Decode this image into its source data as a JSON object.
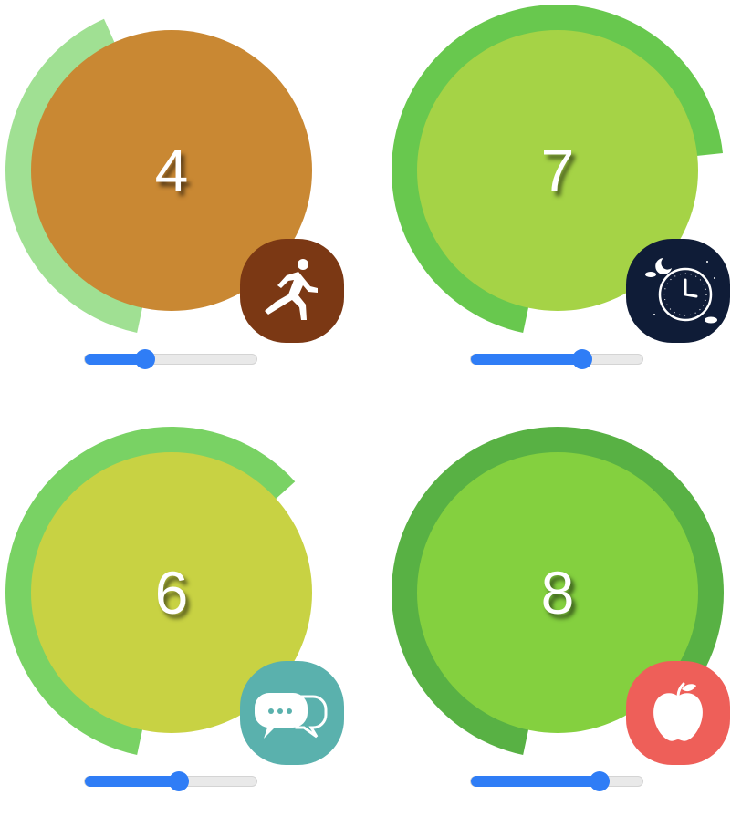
{
  "gauges": [
    {
      "name": "activity",
      "value": "4",
      "level": 0.4,
      "ring_color": "#a0e093",
      "inner_color": "#c98833",
      "badge_color": "#7b3814",
      "icon": "runner-icon",
      "slider_fraction": 0.35
    },
    {
      "name": "sleep",
      "value": "7",
      "level": 0.7,
      "ring_color": "#68c84e",
      "inner_color": "#a5d346",
      "badge_color": "#0f1c37",
      "icon": "night-clock-icon",
      "slider_fraction": 0.65
    },
    {
      "name": "social",
      "value": "6",
      "level": 0.6,
      "ring_color": "#79d264",
      "inner_color": "#c8d243",
      "badge_color": "#5ab1ad",
      "icon": "chat-bubbles-icon",
      "slider_fraction": 0.55
    },
    {
      "name": "nutrition",
      "value": "8",
      "level": 0.8,
      "ring_color": "#58b144",
      "inner_color": "#84d03f",
      "badge_color": "#ee5f59",
      "icon": "apple-icon",
      "slider_fraction": 0.75
    }
  ]
}
